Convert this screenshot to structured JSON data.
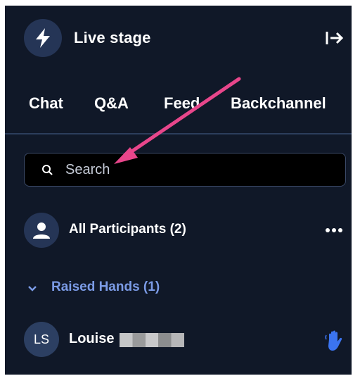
{
  "header": {
    "title": "Live stage",
    "icon": "bolt-icon",
    "exit_icon": "exit-icon"
  },
  "tabs": [
    {
      "label": "Chat"
    },
    {
      "label": "Q&A"
    },
    {
      "label": "Feed"
    },
    {
      "label": "Backchannel"
    }
  ],
  "search": {
    "placeholder": "Search",
    "value": ""
  },
  "participants": {
    "label": "All Participants (2)",
    "menu_icon": "more-icon"
  },
  "raised_hands": {
    "label": "Raised Hands (1)",
    "expanded": true
  },
  "users": [
    {
      "initials": "LS",
      "name": "Louise",
      "status_icon": "raised-hand-icon"
    }
  ],
  "colors": {
    "panel_bg": "#101828",
    "accent_circle": "#253556",
    "section_blue": "#7b9be6",
    "hand_blue": "#3b74f0",
    "annotation_arrow": "#e8468b"
  }
}
